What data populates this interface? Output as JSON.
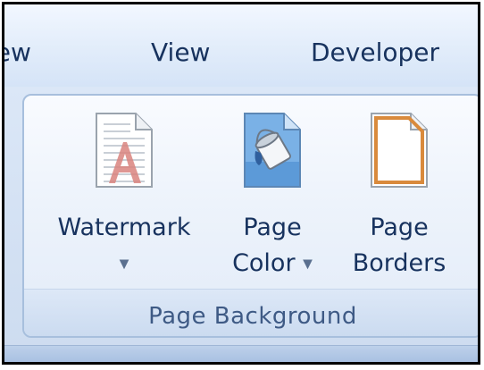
{
  "tabs": {
    "review": "iew",
    "view": "View",
    "developer": "Developer"
  },
  "group": {
    "title": "Page Background",
    "buttons": [
      {
        "line1": "Watermark",
        "line2": "▼",
        "icon": "watermark-icon"
      },
      {
        "line1": "Page",
        "line2": "Color",
        "line2_arrow": "▼",
        "icon": "page-color-icon"
      },
      {
        "line1": "Page",
        "line2": "Borders",
        "icon": "page-borders-icon"
      }
    ]
  },
  "colors": {
    "tab_text": "#17325e",
    "group_title": "#3e5a85",
    "watermark_letter": "#c75a5a",
    "bucket_blue": "#4a84c8",
    "border_orange": "#d98a3c"
  }
}
